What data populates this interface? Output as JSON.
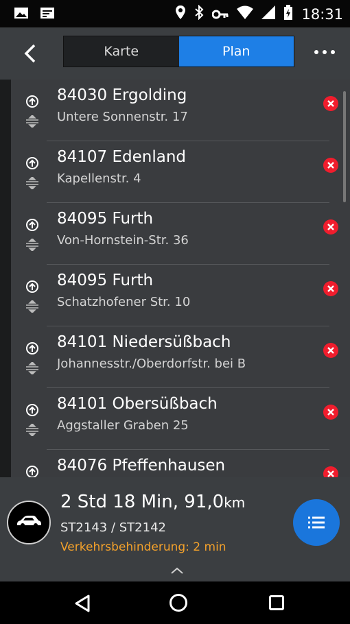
{
  "status_bar": {
    "time": "18:31",
    "icons": [
      "image-icon",
      "cast-icon",
      "location-icon",
      "bluetooth-icon",
      "vpn-key-icon",
      "wifi-icon",
      "signal-icon",
      "battery-icon"
    ]
  },
  "header": {
    "tabs": [
      {
        "label": "Karte",
        "selected": false
      },
      {
        "label": "Plan",
        "selected": true
      }
    ]
  },
  "stops": [
    {
      "city": "84030 Ergolding",
      "street": "Untere Sonnenstr. 17"
    },
    {
      "city": "84107 Edenland",
      "street": "Kapellenstr. 4"
    },
    {
      "city": "84095 Furth",
      "street": "Von-Hornstein-Str. 36"
    },
    {
      "city": "84095 Furth",
      "street": "Schatzhofener Str. 10"
    },
    {
      "city": "84101 Niedersüßbach",
      "street": "Johannesstr./Oberdorfstr. bei B"
    },
    {
      "city": "84101 Obersüßbach",
      "street": "Aggstaller Graben 25"
    },
    {
      "city": "84076 Pfeffenhausen",
      "street": ""
    }
  ],
  "summary": {
    "duration": "2 Std 18 Min, 91,0",
    "distance_unit": "km",
    "route": "ST2143 / ST2142",
    "traffic": "Verkehrsbehinderung: 2 min"
  },
  "colors": {
    "accent": "#1e7fe6",
    "delete": "#f01d2d",
    "traffic": "#f3a12b"
  }
}
